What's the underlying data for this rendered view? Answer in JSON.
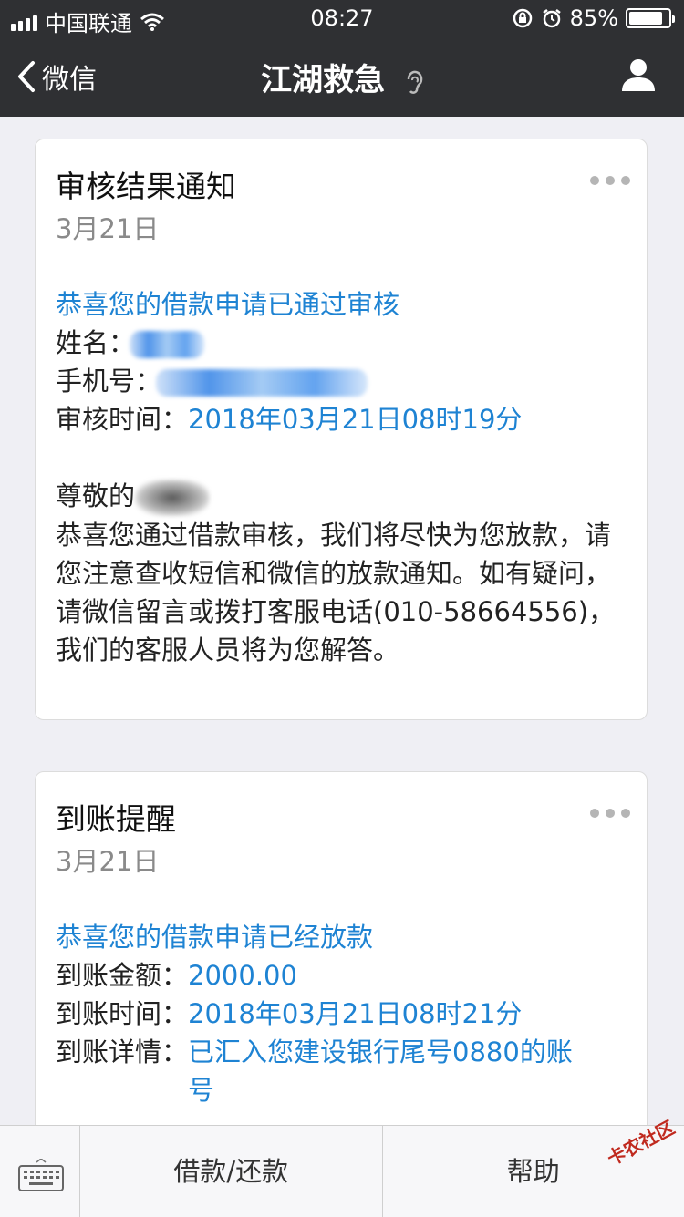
{
  "status_bar": {
    "carrier": "中国联通",
    "time": "08:27",
    "battery": "85%",
    "battery_level": 0.85
  },
  "nav": {
    "back_label": "微信",
    "title": "江湖救急"
  },
  "card1": {
    "title": "审核结果通知",
    "date": "3月21日",
    "headline": "恭喜您的借款申请已通过审核",
    "name_label": "姓名：",
    "phone_label": "手机号：",
    "review_time_label": "审核时间：",
    "review_time_value": "2018年03月21日08时19分",
    "greeting": "尊敬的",
    "body": "恭喜您通过借款审核，我们将尽快为您放款，请您注意查收短信和微信的放款通知。如有疑问，请微信留言或拨打客服电话(010-58664556)，我们的客服人员将为您解答。"
  },
  "card2": {
    "title": "到账提醒",
    "date": "3月21日",
    "headline": "恭喜您的借款申请已经放款",
    "amount_label": "到账金额：",
    "amount_value": "2000.00",
    "time_label": "到账时间：",
    "time_value": "2018年03月21日08时21分",
    "detail_label": "到账详情：",
    "detail_value": "已汇入您建设银行尾号0880的账号"
  },
  "menu": {
    "items": [
      "借款/还款",
      "帮助"
    ]
  },
  "watermark": "卡农社区",
  "icons": {
    "signal": "signal-icon",
    "wifi": "wifi-icon",
    "lock": "rotation-lock-icon",
    "alarm": "alarm-icon",
    "back": "chevron-left-icon",
    "ear": "ear-icon",
    "profile": "person-icon",
    "more": "more-dots-icon",
    "keyboard": "keyboard-icon"
  }
}
